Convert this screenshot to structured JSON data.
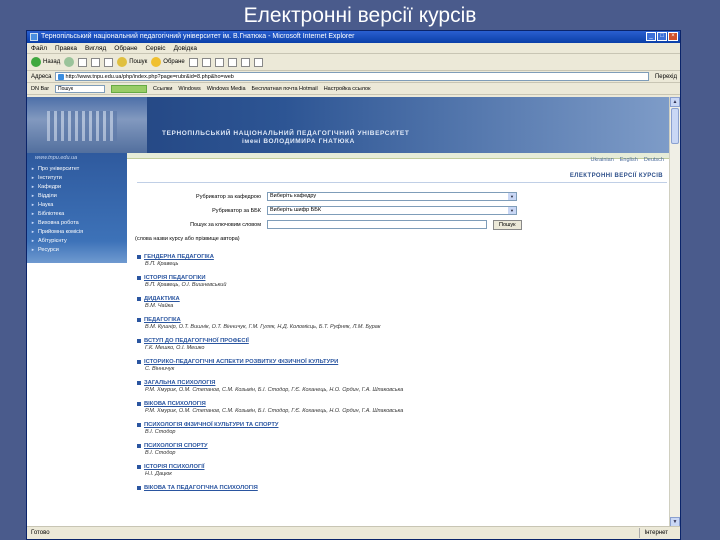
{
  "slide": {
    "title": "Електронні версії курсів"
  },
  "window": {
    "title": "Тернопільський національний педагогічний університет ім. В.Гнатюка - Microsoft Internet Explorer",
    "menu": [
      "Файл",
      "Правка",
      "Вигляд",
      "Обране",
      "Сервіс",
      "Довідка"
    ],
    "toolbar": {
      "back": "Назад",
      "search": "Пошук",
      "favorites": "Обране"
    },
    "address": {
      "label": "Адреса",
      "url": "http://www.tnpu.edu.ua/php/index.php?page=rubr&id=8.php&ho=web",
      "go": "Перехід"
    },
    "links": {
      "dnbar": "DN Bar",
      "search_select": "Пошук",
      "items": [
        "Ссылки",
        "Windows",
        "Windows Media",
        "Бесплатная почта Hotmail",
        "Настройка ссылок"
      ]
    },
    "status": {
      "left": "Готово",
      "zone": "Інтернет"
    }
  },
  "site": {
    "university_line1": "ТЕРНОПІЛЬСЬКИЙ НАЦІОНАЛЬНИЙ ПЕДАГОГІЧНИЙ УНІВЕРСИТЕТ",
    "university_line2": "імені ВОЛОДИМИРА ГНАТЮКА",
    "site_url": "www.tnpu.edu.ua",
    "nav": [
      "Про університет",
      "Інститути",
      "Кафедри",
      "Відділи",
      "Наука",
      "Бібліотека",
      "Виховна робота",
      "Прийомна комісія",
      "Абітурієнту",
      "Ресурси"
    ],
    "languages": [
      "Ukrainian",
      "English",
      "Deutsch"
    ]
  },
  "page": {
    "heading": "ЕЛЕКТРОННІ ВЕРСІЇ КУРСІВ",
    "form": {
      "by_department_label": "Рубрикатор за кафедрою",
      "by_department_value": "Виберіть кафедру",
      "by_udc_label": "Рубрикатор за ББК",
      "by_udc_value": "Виберіть шифр ББК",
      "search_label": "Пошук за ключовим словом",
      "search_hint": "(слова назви курсу або прізвище автора)",
      "search_button": "Пошук"
    },
    "courses": [
      {
        "title": "ГЕНДЕРНА ПЕДАГОГІКА",
        "authors": "В.П. Кравець"
      },
      {
        "title": "ІСТОРІЯ ПЕДАГОГІКИ",
        "authors": "В.П. Кравець, О.І. Вишневський"
      },
      {
        "title": "ДИДАКТИКА",
        "authors": "В.М. Чайка"
      },
      {
        "title": "ПЕДАГОГІКА",
        "authors": "В.М. Кушнір, О.Т. Вишнік, О.Т. Вінничук, Г.М. Гуляк, Н.Д. Коломієць, Б.Т. Руфняк, Л.М. Бурак"
      },
      {
        "title": "ВСТУП ДО ПЕДАГОГІЧНОЇ ПРОФЕСІЇ",
        "authors": "Г.К. Мешко, О.І. Мешко"
      },
      {
        "title": "ІСТОРИКО-ПЕДАГОГІЧНІ АСПЕКТИ РОЗВИТКУ ФІЗИЧНОЇ КУЛЬТУРИ",
        "authors": "С. Вінничук"
      },
      {
        "title": "ЗАГАЛЬНА ПСИХОЛОГІЯ",
        "authors": "Р.М. Хмурик, О.М. Степанов, С.М. Козьмін, Б.І. Стодор, Г.Є. Коханець, Н.О. Ордин, Г.А. Шпаковська"
      },
      {
        "title": "ВІКОВА ПСИХОЛОГІЯ",
        "authors": "Р.М. Хмурик, О.М. Степанов, С.М. Козьмін, Б.І. Стодор, Г.Є. Коханець, Н.О. Ордин, Г.А. Шпаковська"
      },
      {
        "title": "ПСИХОЛОГІЯ ФІЗИЧНОЇ КУЛЬТУРИ ТА СПОРТУ",
        "authors": "В.І. Стодор"
      },
      {
        "title": "ПСИХОЛОГІЯ СПОРТУ",
        "authors": "В.І. Стодор"
      },
      {
        "title": "ІСТОРІЯ ПСИХОЛОГІЇ",
        "authors": "Н.І. Дацюк"
      },
      {
        "title": "ВІКОВА ТА ПЕДАГОГІЧНА ПСИХОЛОГІЯ",
        "authors": ""
      }
    ]
  },
  "colors": {
    "slide_bg": "#4a5b8c",
    "banner": "#2d5594",
    "link": "#2a55a0"
  }
}
